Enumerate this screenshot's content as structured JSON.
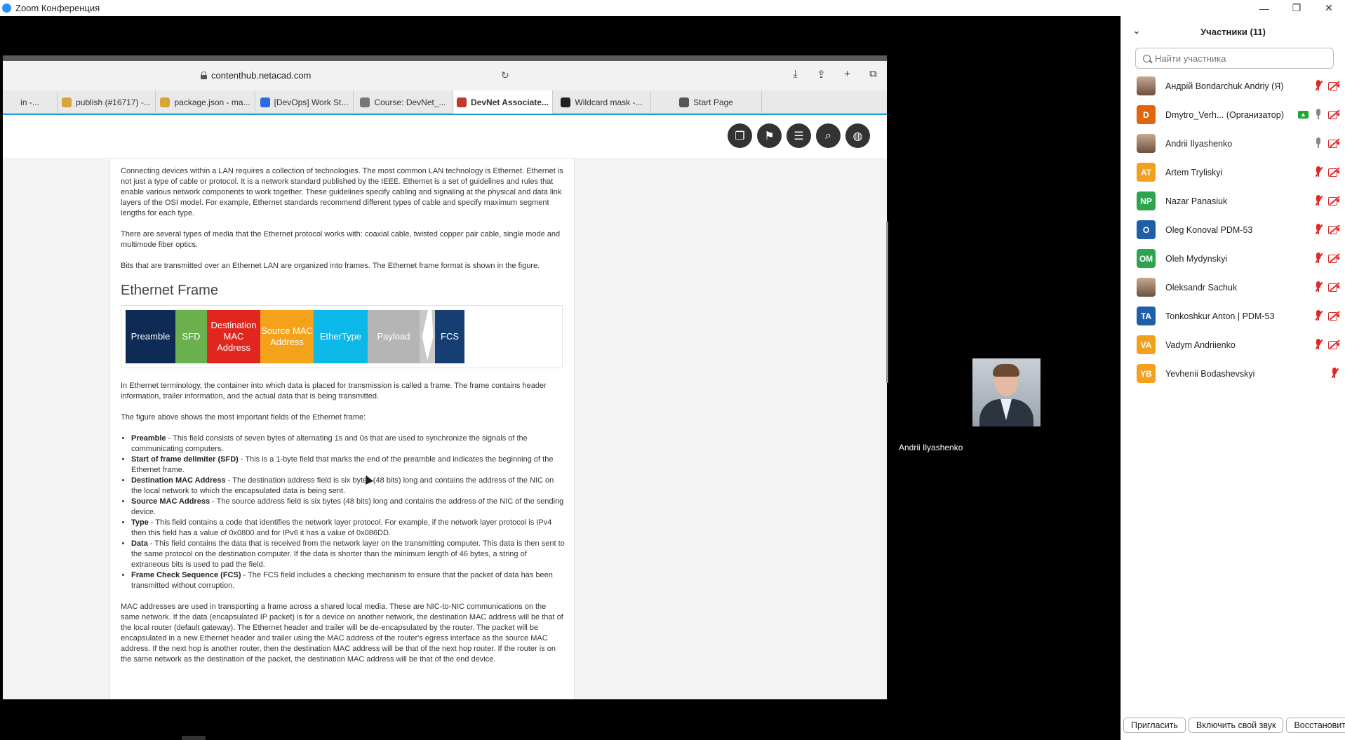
{
  "window": {
    "title": "Zoom Конференция",
    "controls": [
      "—",
      "❐",
      "✕"
    ]
  },
  "browser": {
    "url": "contenthub.netacad.com",
    "tabs": [
      {
        "label": "in -...",
        "icon": "tab-icon",
        "color": "#888888",
        "active": false
      },
      {
        "label": "publish (#16717) -...",
        "icon": "jenkins-icon",
        "color": "#d9a43a",
        "active": false
      },
      {
        "label": "package.json - ma...",
        "icon": "jenkins-icon",
        "color": "#d9a43a",
        "active": false
      },
      {
        "label": "[DevOps] Work St...",
        "icon": "jira-icon",
        "color": "#2d6cdf",
        "active": false
      },
      {
        "label": "Course: DevNet_...",
        "icon": "course-icon",
        "color": "#777777",
        "active": false
      },
      {
        "label": "DevNet Associate...",
        "icon": "netacad-icon",
        "color": "#c0392b",
        "active": true
      },
      {
        "label": "Wildcard mask -...",
        "icon": "wikipedia-icon",
        "color": "#222222",
        "active": false
      },
      {
        "label": "Start Page",
        "icon": "star-icon",
        "color": "#555555",
        "active": false
      }
    ]
  },
  "article": {
    "p1": "Connecting devices within a LAN requires a collection of technologies. The most common LAN technology is Ethernet. Ethernet is not just a type of cable or protocol. It is a network standard published by the IEEE. Ethernet is a set of guidelines and rules that enable various network components to work together. These guidelines specify cabling and signaling at the physical and data link layers of the OSI model. For example, Ethernet standards recommend different types of cable and specify maximum segment lengths for each type.",
    "p2": "There are several types of media that the Ethernet protocol works with: coaxial cable, twisted copper pair cable, single mode and multimode fiber optics.",
    "p3": "Bits that are transmitted over an Ethernet LAN are organized into frames. The Ethernet frame format is shown in the figure.",
    "heading": "Ethernet Frame",
    "frame": [
      {
        "label": "Preamble",
        "color": "#0d2b55"
      },
      {
        "label": "SFD",
        "color": "#6ab04c"
      },
      {
        "label": "Destination MAC Address",
        "color": "#e0261f"
      },
      {
        "label": "Source MAC Address",
        "color": "#f5a21b"
      },
      {
        "label": "EtherType",
        "color": "#0cb8e8"
      },
      {
        "label": "Payload",
        "color": "#b5b5b5"
      },
      {
        "label": "FCS",
        "color": "#173e73"
      }
    ],
    "p4": "In Ethernet terminology, the container into which data is placed for transmission is called a frame. The frame contains header information, trailer information, and the actual data that is being transmitted.",
    "p5": "The figure above shows the most important fields of the Ethernet frame:",
    "fields": [
      {
        "term": "Preamble",
        "desc": " - This field consists of seven bytes of alternating 1s and 0s that are used to synchronize the signals of the communicating computers."
      },
      {
        "term": "Start of frame delimiter (SFD)",
        "desc": " - This is a 1-byte field that marks the end of the preamble and indicates the beginning of the Ethernet frame."
      },
      {
        "term": "Destination MAC Address",
        "desc": " - The destination address field is six bytes (48 bits) long and contains the address of the NIC on the local network to which the encapsulated data is being sent."
      },
      {
        "term": "Source MAC Address",
        "desc": " - The source address field is six bytes (48 bits) long and contains the address of the NIC of the sending device."
      },
      {
        "term": "Type",
        "desc": " - This field contains a code that identifies the network layer protocol. For example, if the network layer protocol is IPv4 then this field has a value of 0x0800 and for IPv6 it has a value of 0x086DD."
      },
      {
        "term": "Data",
        "desc": " - This field contains the data that is received from the network layer on the transmitting computer. This data is then sent to the same protocol on the destination computer. If the data is shorter than the minimum length of 46 bytes, a string of extraneous bits is used to pad the field."
      },
      {
        "term": "Frame Check Sequence (FCS)",
        "desc": " - The FCS field includes a checking mechanism to ensure that the packet of data has been transmitted without corruption."
      }
    ],
    "p6": "MAC addresses are used in transporting a frame across a shared local media. These are NIC-to-NIC communications on the same network. If the data (encapsulated IP packet) is for a device on another network, the destination MAC address will be that of the local router (default gateway). The Ethernet header and trailer will be de-encapsulated by the router. The packet will be encapsulated in a new Ethernet header and trailer using the MAC address of the router's egress interface as the source MAC address. If the next hop is another router, then the destination MAC address will be that of the next hop router. If the router is on the same network as the destination of the packet, the destination MAC address will be that of the end device."
  },
  "speaker": {
    "name": "Andrii Ilyashenko"
  },
  "participants": {
    "title": "Участники (11)",
    "search_placeholder": "Найти участника",
    "list": [
      {
        "name": "Андрій Bondarchuk Andriy (Я)",
        "initials": "",
        "color": "#8a6a55",
        "photo": true,
        "mic": "muted",
        "cam": true,
        "share": false
      },
      {
        "name": "Dmytro_Verh... (Организатор)",
        "initials": "D",
        "color": "#e0650e",
        "photo": false,
        "mic": "on",
        "cam": true,
        "share": true
      },
      {
        "name": "Andrii Ilyashenko",
        "initials": "",
        "color": "#555555",
        "photo": true,
        "mic": "on",
        "cam": true,
        "share": false
      },
      {
        "name": "Artem Tryliskyi",
        "initials": "AT",
        "color": "#f2a01e",
        "photo": false,
        "mic": "muted",
        "cam": true,
        "share": false
      },
      {
        "name": "Nazar Panasiuk",
        "initials": "NP",
        "color": "#2ea44f",
        "photo": false,
        "mic": "muted",
        "cam": true,
        "share": false
      },
      {
        "name": "Oleg Konoval PDM-53",
        "initials": "O",
        "color": "#1f5fa8",
        "photo": false,
        "mic": "muted",
        "cam": true,
        "share": false
      },
      {
        "name": "Oleh Mydynskyi",
        "initials": "OM",
        "color": "#2ea44f",
        "photo": false,
        "mic": "muted",
        "cam": true,
        "share": false
      },
      {
        "name": "Oleksandr Sachuk",
        "initials": "",
        "color": "#a07a60",
        "photo": true,
        "mic": "muted",
        "cam": true,
        "share": false
      },
      {
        "name": "Tonkoshkur Anton | PDM-53",
        "initials": "TA",
        "color": "#1f5fa8",
        "photo": false,
        "mic": "muted",
        "cam": true,
        "share": false
      },
      {
        "name": "Vadym Andriienko",
        "initials": "VA",
        "color": "#f2a01e",
        "photo": false,
        "mic": "muted",
        "cam": true,
        "share": false
      },
      {
        "name": "Yevhenii Bodashevskyi",
        "initials": "YB",
        "color": "#f2a01e",
        "photo": false,
        "mic": "muted",
        "cam": false,
        "share": false
      }
    ],
    "footer": {
      "invite": "Пригласить",
      "unmute": "Включить свой звук",
      "restore": "Восстановит"
    }
  }
}
